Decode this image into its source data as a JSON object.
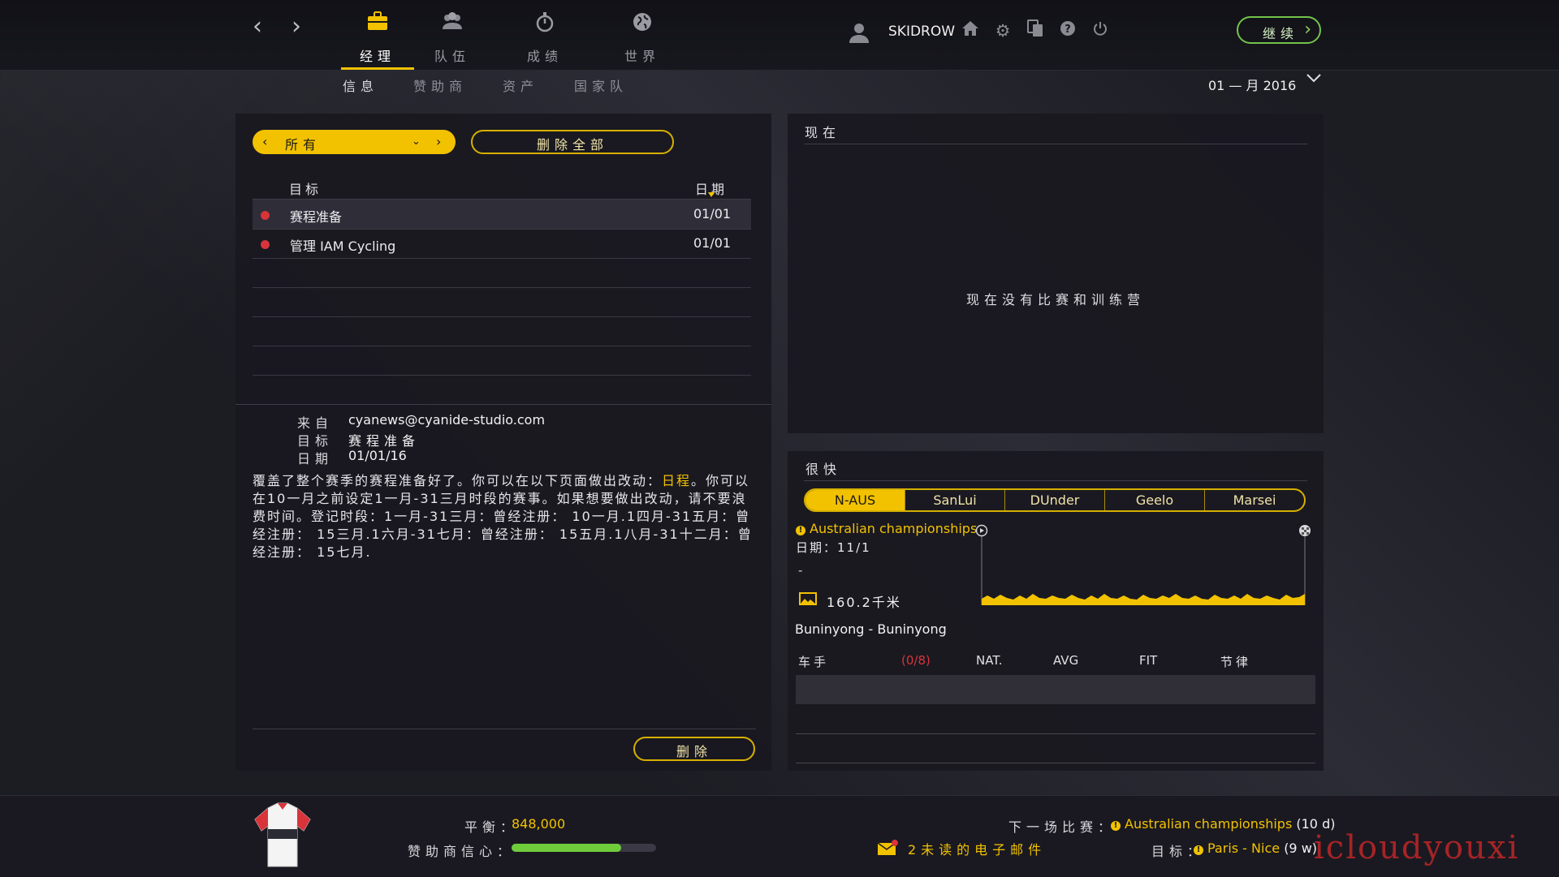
{
  "topbar": {
    "main_tabs": [
      {
        "label": "经理",
        "icon": "briefcase-icon",
        "active": true
      },
      {
        "label": "队伍",
        "icon": "team-icon",
        "active": false
      },
      {
        "label": "成绩",
        "icon": "stopwatch-icon",
        "active": false
      },
      {
        "label": "世界",
        "icon": "globe-icon",
        "active": false
      }
    ],
    "sub_tabs": [
      {
        "label": "信息",
        "active": true
      },
      {
        "label": "赞助商",
        "active": false
      },
      {
        "label": "资产",
        "active": false
      },
      {
        "label": "国家队",
        "active": false
      }
    ],
    "username": "SKIDROW",
    "icons": [
      "home-icon",
      "gear-icon",
      "copy-icon",
      "help-icon",
      "power-icon"
    ],
    "continue_label": "继续",
    "date": "01 — 月 2016"
  },
  "messages": {
    "filter_label": "所有",
    "delete_all_label": "删除全部",
    "col_subject": "目标",
    "col_date": "日期",
    "rows": [
      {
        "subject": "赛程准备",
        "date": "01/01",
        "unread": true
      },
      {
        "subject": "管理 IAM Cycling",
        "date": "01/01",
        "unread": true
      }
    ],
    "detail": {
      "from_label": "来自",
      "from_value": "cyanews@cyanide-studio.com",
      "subject_label": "目标",
      "subject_value": "赛程准备",
      "date_label": "日期",
      "date_value": "01/01/16",
      "body_part1": "覆盖了整个赛季的赛程准备好了。你可以在以下页面做出改动：",
      "body_link": "日程",
      "body_part2": "。你可以在10一月之前设定1一月-31三月时段的赛事。如果想要做出改动，请不要浪费时间。登记时段：1一月-31三月：曾经注册： 10一月.1四月-31五月：曾经注册： 15三月.1六月-31七月：曾经注册： 15五月.1八月-31十二月：曾经注册： 15七月."
    },
    "delete_label": "删除"
  },
  "now_panel": {
    "title": "现在",
    "empty_text": "现在没有比赛和训练营"
  },
  "soon_panel": {
    "title": "很快",
    "tabs": [
      {
        "label": "N-AUS",
        "active": true
      },
      {
        "label": "SanLui",
        "active": false
      },
      {
        "label": "DUnder",
        "active": false
      },
      {
        "label": "Geelo",
        "active": false
      },
      {
        "label": "Marsei",
        "active": false
      }
    ],
    "race_name": "Australian championships",
    "race_date": "日期：11/1",
    "race_dash": "-",
    "distance": "160.2千米",
    "route": "Buninyong - Buninyong",
    "col_rider": "车手",
    "rider_count": "(0/8)",
    "col_nat": "NAT.",
    "col_avg": "AVG",
    "col_fit": "FIT",
    "col_rhythm": "节律"
  },
  "footer": {
    "balance_label": "平衡：",
    "balance_value": "848,000",
    "confidence_label": "赞助商信心：",
    "confidence_pct": 76,
    "unread_mail": "2未读的电子邮件",
    "next_race_label": "下一场比赛：",
    "next_race_value": "Australian championships",
    "next_race_days": "(10 d)",
    "goal_label": "目标：",
    "goal_value": "Paris - Nice",
    "goal_weeks": "(9 w)"
  },
  "watermark": "icloudyouxi",
  "colors": {
    "accent": "#f2c200",
    "continue_green": "#73c44a",
    "unread_dot": "#d8343a",
    "confidence_bar": "#6fcd3c"
  }
}
